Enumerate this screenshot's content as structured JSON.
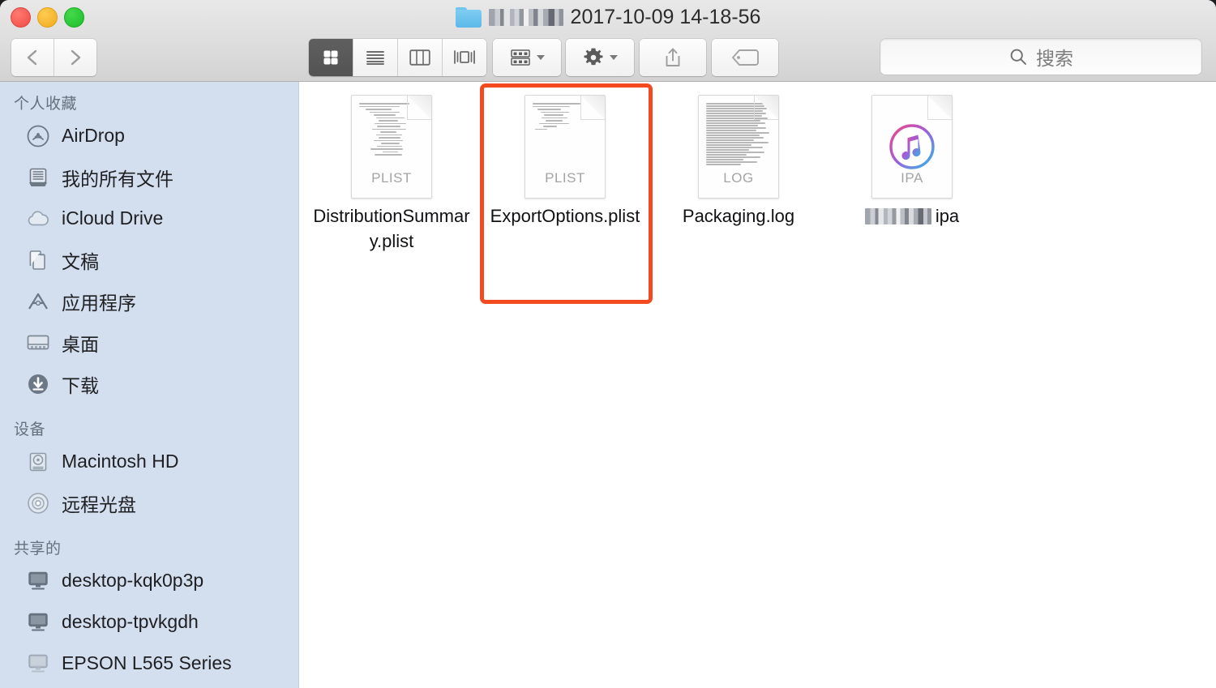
{
  "window": {
    "title_prefix_redacted": true,
    "title": "2017-10-09 14-18-56",
    "folder_icon": "folder-icon",
    "traffic_lights": {
      "close_label": "Close",
      "minimize_label": "Minimize",
      "zoom_label": "Zoom",
      "close_color": "#f04b44",
      "minimize_color": "#f0ab1b",
      "zoom_color": "#1bbd2a"
    }
  },
  "toolbar": {
    "back_label": "Back",
    "forward_label": "Forward",
    "view_modes": [
      {
        "name": "icon-view",
        "label": "Icon View",
        "active": true
      },
      {
        "name": "list-view",
        "label": "List View",
        "active": false
      },
      {
        "name": "column-view",
        "label": "Column View",
        "active": false
      },
      {
        "name": "cover-flow-view",
        "label": "Cover Flow View",
        "active": false
      }
    ],
    "arrange_label": "Arrange",
    "action_label": "Action",
    "share_label": "Share",
    "tag_label": "Edit Tags",
    "share_disabled": true,
    "tag_disabled": true
  },
  "search": {
    "placeholder": "搜索",
    "value": "",
    "icon": "search-icon"
  },
  "sidebar": {
    "sections": [
      {
        "title": "个人收藏",
        "items": [
          {
            "label": "AirDrop",
            "icon": "airdrop-icon"
          },
          {
            "label": "我的所有文件",
            "icon": "all-my-files-icon"
          },
          {
            "label": "iCloud Drive",
            "icon": "icloud-icon"
          },
          {
            "label": "文稿",
            "icon": "documents-icon"
          },
          {
            "label": "应用程序",
            "icon": "applications-icon"
          },
          {
            "label": "桌面",
            "icon": "desktop-icon"
          },
          {
            "label": "下载",
            "icon": "downloads-icon"
          }
        ]
      },
      {
        "title": "设备",
        "items": [
          {
            "label": "Macintosh HD",
            "icon": "hard-disk-icon"
          },
          {
            "label": "远程光盘",
            "icon": "remote-disc-icon"
          }
        ]
      },
      {
        "title": "共享的",
        "items": [
          {
            "label": "desktop-kqk0p3p",
            "icon": "computer-icon"
          },
          {
            "label": "desktop-tpvkgdh",
            "icon": "computer-icon"
          },
          {
            "label": "EPSON L565 Series",
            "icon": "computer-icon"
          }
        ]
      }
    ]
  },
  "content": {
    "files": [
      {
        "name": "DistributionSummary.plist",
        "kind_label": "PLIST",
        "icon": "plist-document-icon",
        "redacted_name": false,
        "selected": false
      },
      {
        "name": "ExportOptions.plist",
        "kind_label": "PLIST",
        "icon": "plist-document-icon",
        "redacted_name": false,
        "selected": false,
        "annotated": true
      },
      {
        "name": "Packaging.log",
        "kind_label": "LOG",
        "icon": "log-document-icon",
        "redacted_name": false,
        "selected": false
      },
      {
        "name": "ipa",
        "kind_label": "IPA",
        "icon": "ipa-itunes-icon",
        "redacted_name": true,
        "selected": false
      }
    ]
  },
  "annotation": {
    "color": "#f44a20",
    "target": "ExportOptions.plist",
    "shape": "rounded-rectangle"
  }
}
